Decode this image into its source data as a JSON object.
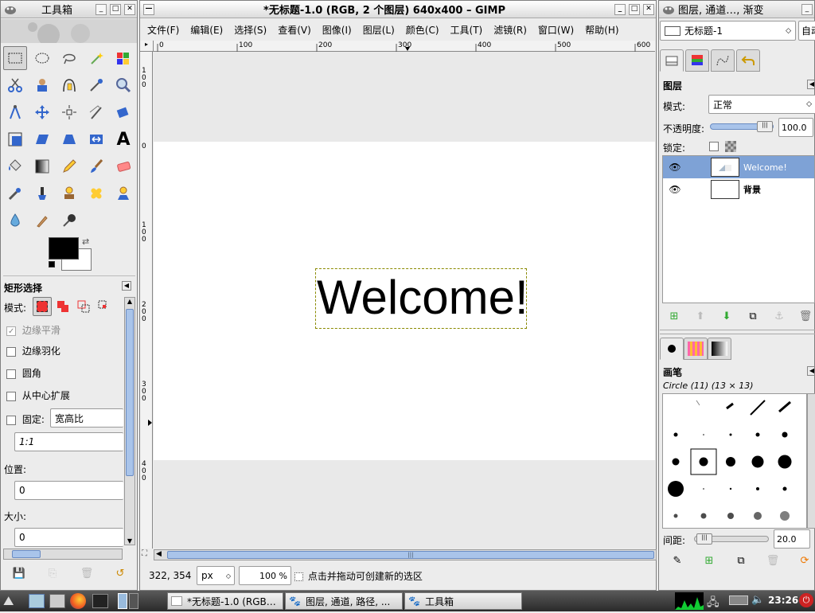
{
  "toolbox": {
    "title": "工具箱",
    "options_title": "矩形选择",
    "mode_label": "模式:",
    "antialias": "边缘平滑",
    "feather": "边缘羽化",
    "rounded": "圆角",
    "expand_center": "从中心扩展",
    "fixed": "固定:",
    "fixed_value": "宽高比",
    "ratio_value": "1:1",
    "position_label": "位置:",
    "position_value": "0",
    "size_label": "大小:",
    "size_value": "0",
    "fg_color": "#000000",
    "bg_color": "#ffffff"
  },
  "canvas_window": {
    "title": "*无标题-1.0 (RGB, 2 个图层) 640x400 – GIMP",
    "menu": [
      "文件(F)",
      "编辑(E)",
      "选择(S)",
      "查看(V)",
      "图像(I)",
      "图层(L)",
      "颜色(C)",
      "工具(T)",
      "滤镜(R)",
      "窗口(W)",
      "帮助(H)"
    ],
    "ruler_h": [
      "0",
      "100",
      "200",
      "300",
      "400",
      "500",
      "600"
    ],
    "ruler_v": [
      "100",
      "0",
      "100",
      "200",
      "300",
      "400"
    ],
    "text_layer": "Welcome!",
    "status_coords": "322, 354",
    "unit": "px",
    "zoom": "100 %",
    "status_hint": "点击并拖动可创建新的选区"
  },
  "dock": {
    "title": "图层, 通道…, 渐变",
    "image_select": "无标题-1",
    "auto_btn": "自动",
    "layers_title": "图层",
    "mode_label": "模式:",
    "mode_value": "正常",
    "opacity_label": "不透明度:",
    "opacity_value": "100.0",
    "lock_label": "锁定:",
    "layers": [
      {
        "name": "Welcome!",
        "selected": true
      },
      {
        "name": "背景",
        "selected": false
      }
    ],
    "brushes_title": "画笔",
    "brush_name": "Circle (11) (13 × 13)",
    "spacing_label": "间距:",
    "spacing_value": "20.0"
  },
  "taskbar": {
    "tasks": [
      "*无标题-1.0 (RGB…",
      "图层, 通道, 路径, ...",
      "工具箱"
    ],
    "clock": "23:26"
  }
}
